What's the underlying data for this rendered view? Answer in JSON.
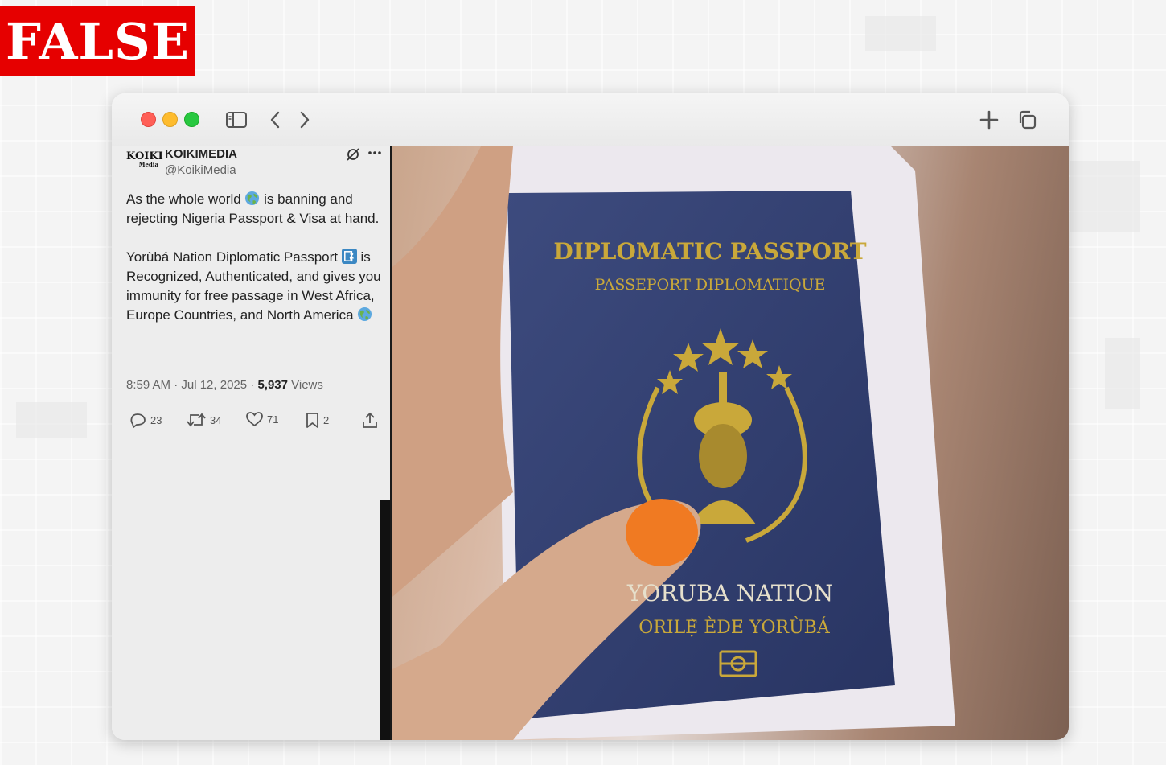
{
  "verdict_badge": "FALSE",
  "browser": {
    "traffic_lights": [
      "close",
      "minimize",
      "zoom"
    ],
    "toolbar_icons": [
      "sidebar-icon",
      "back-chevron-icon",
      "forward-chevron-icon",
      "plus-icon",
      "tabs-overview-icon"
    ]
  },
  "tweet": {
    "avatar_text": "KOIKI",
    "avatar_subtext": "Media",
    "author_name": "KOIKIMEDIA",
    "author_handle": "@KoikiMedia",
    "text_p1_a": "As the whole world",
    "text_p1_b": "is banning and rejecting Nigeria Passport & Visa at hand.",
    "text_p2_a": "Yorùbá Nation Diplomatic Passport",
    "text_p2_b": "is Recognized, Authenticated, and gives you immunity for free passage in West Africa, Europe Countries, and North America",
    "timestamp": "8:59 AM · Jul 12, 2025 · ",
    "views_count": "5,937",
    "views_label": " Views",
    "replies": "23",
    "reposts": "34",
    "likes": "71",
    "bookmarks": "2"
  },
  "photo": {
    "passport_title": "DIPLOMATIC PASSPORT",
    "passport_subtitle": "PASSEPORT DIPLOMATIQUE",
    "passport_nation": "YORUBA NATION",
    "passport_native": "ORILẸ̀ ÈDE YORÙBÁ"
  },
  "colors": {
    "badge": "#e60000",
    "passport_cover": "#33406e",
    "passport_gold": "#c9a83a"
  }
}
